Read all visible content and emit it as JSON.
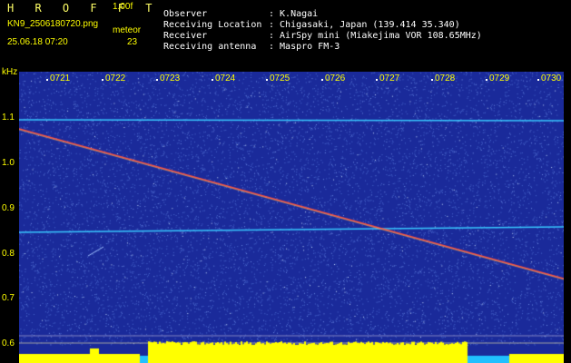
{
  "header": {
    "title": "H R O F F T",
    "version": "1.00f",
    "filename": "KN9_2506180720.png",
    "timestamp": "25.06.18 07:20",
    "meteor_label": "meteor",
    "meteor_count": "23"
  },
  "meta": [
    {
      "key": "Observer",
      "value": ": K.Nagai"
    },
    {
      "key": "Receiving Location",
      "value": ": Chigasaki, Japan (139.414 35.340)"
    },
    {
      "key": "Receiver",
      "value": ": AirSpy mini (Miakejima VOR 108.65MHz)"
    },
    {
      "key": "Receiving antenna",
      "value": ": Maspro FM-3"
    }
  ],
  "spectrogram": {
    "y_unit": "kHz",
    "y_ticks": [
      "1.1",
      "1.0",
      "0.9",
      "0.8",
      "0.7",
      "0.6"
    ],
    "x_ticks": [
      "0721",
      "0722",
      "0723",
      "0724",
      "0725",
      "0726",
      "0727",
      "0728",
      "0729",
      "0730"
    ],
    "colors": {
      "background": "#1a2a9a",
      "noise": "#4a6ad0",
      "carrier": "#38c8ff",
      "trace": "#ff5040",
      "level": "#ffff00",
      "base": "#20c0ff"
    }
  }
}
